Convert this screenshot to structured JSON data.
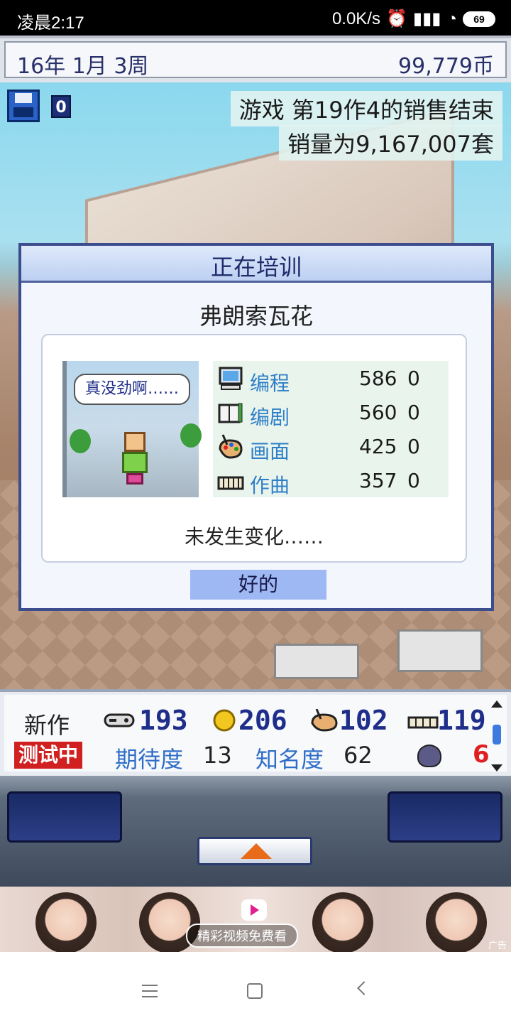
{
  "status_bar": {
    "time": "凌晨2:17",
    "net_speed": "0.0K/s",
    "battery": "69"
  },
  "game_bar": {
    "date": "16年 1月 3周",
    "money": "99,779币"
  },
  "scene": {
    "save_badge": "0",
    "notice_line1": "游戏 第19作4的销售结束",
    "notice_line2": "销量为9,167,007套"
  },
  "dialog": {
    "title": "正在培训",
    "employee_name": "弗朗索瓦花",
    "speech": "真没劲啊……",
    "stats": [
      {
        "icon": "computer-icon",
        "label": "编程",
        "value": "586",
        "delta": "0"
      },
      {
        "icon": "book-icon",
        "label": "编剧",
        "value": "560",
        "delta": "0"
      },
      {
        "icon": "palette-icon",
        "label": "画面",
        "value": "425",
        "delta": "0"
      },
      {
        "icon": "keyboard-icon",
        "label": "作曲",
        "value": "357",
        "delta": "0"
      }
    ],
    "result": "未发生变化……",
    "ok_label": "好的"
  },
  "info_bar": {
    "new_label": "新作",
    "testing_label": "测试中",
    "metrics": [
      {
        "icon": "controller-icon",
        "value": "193"
      },
      {
        "icon": "coin-icon",
        "value": "206"
      },
      {
        "icon": "palette-icon",
        "value": "102"
      },
      {
        "icon": "keyboard-icon",
        "value": "119"
      }
    ],
    "expectation_label": "期待度",
    "expectation_value": "13",
    "fame_label": "知名度",
    "fame_value": "62",
    "bug_count": "6"
  },
  "ad": {
    "caption": "精彩视频免费看",
    "tag": "广告"
  },
  "colors": {
    "title_text": "#1f2b6a",
    "stat_label": "#2f7fc8",
    "ok_button": "#9db8f2",
    "bug_count": "#e02020"
  }
}
